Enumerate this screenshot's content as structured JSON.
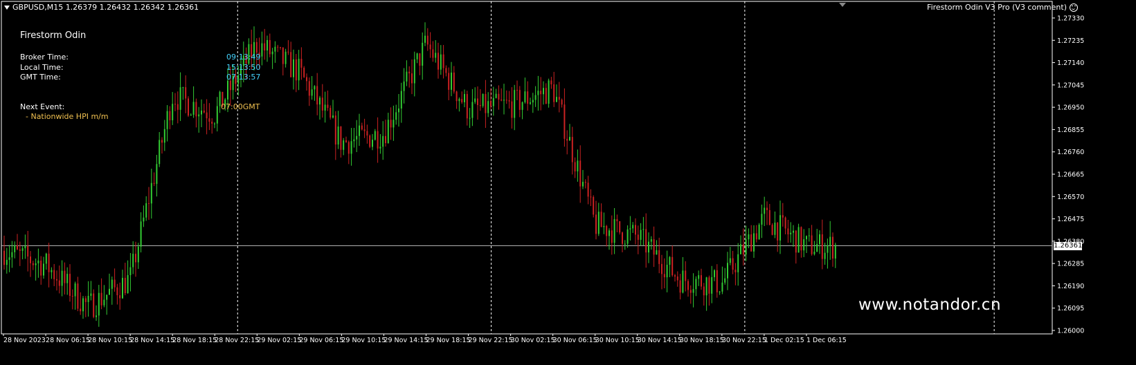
{
  "header": {
    "symbol_info": "GBPUSD,M15  1.26379 1.26432 1.26342 1.26361",
    "indicator_title": "Firestorm Odin V3 Pro (V3 comment)"
  },
  "panel": {
    "title": "Firestorm Odin",
    "broker_label": "Broker Time:",
    "broker_value": "09:13:49",
    "local_label": "Local Time:",
    "local_value": "15:13:50",
    "gmt_label": "GMT Time:",
    "gmt_value": "07:13:57",
    "next_event_label": "Next Event:",
    "next_event_time": "07:00GMT",
    "next_event_name": "- Nationwide HPI m/m"
  },
  "watermark": "www.notandor.cn",
  "colors": {
    "background": "#000000",
    "bull_candle": "#33cc33",
    "bear_candle": "#cc2222",
    "grid": "#ffffff",
    "time_values": "#44d4ff",
    "event_text": "#f0c050"
  },
  "chart_data": {
    "type": "candlestick",
    "current_price": 1.26361,
    "price_tag": "1.26361",
    "ylim": [
      1.26,
      1.2735
    ],
    "y_ticks": [
      "1.27330",
      "1.27235",
      "1.27140",
      "1.27045",
      "1.26950",
      "1.26855",
      "1.26760",
      "1.26665",
      "1.26570",
      "1.26475",
      "1.26380",
      "1.26285",
      "1.26190",
      "1.26095",
      "1.26000"
    ],
    "x_ticks": [
      "28 Nov 2023",
      "28 Nov 06:15",
      "28 Nov 10:15",
      "28 Nov 14:15",
      "28 Nov 18:15",
      "28 Nov 22:15",
      "29 Nov 02:15",
      "29 Nov 06:15",
      "29 Nov 10:15",
      "29 Nov 14:15",
      "29 Nov 18:15",
      "29 Nov 22:15",
      "30 Nov 02:15",
      "30 Nov 06:15",
      "30 Nov 10:15",
      "30 Nov 14:15",
      "30 Nov 18:15",
      "30 Nov 22:15",
      "1 Dec 02:15",
      "1 Dec 06:15"
    ],
    "separator_ticks": [
      "28 Nov 22:15",
      "29 Nov 22:15",
      "30 Nov 22:15"
    ],
    "future_separator_after": "1 Dec 06:15",
    "close_path": [
      [
        "28 Nov 2023",
        1.2634
      ],
      [
        "28 Nov 06:15",
        1.2628
      ],
      [
        "28 Nov 10:15",
        1.261
      ],
      [
        "28 Nov 14:15",
        1.2622
      ],
      [
        "28 Nov 18:15",
        1.27
      ],
      [
        "28 Nov 22:15",
        1.2692
      ],
      [
        "29 Nov 02:15",
        1.2722
      ],
      [
        "29 Nov 06:15",
        1.271
      ],
      [
        "29 Nov 10:15",
        1.268
      ],
      [
        "29 Nov 14:15",
        1.2684
      ],
      [
        "29 Nov 18:15",
        1.2722
      ],
      [
        "29 Nov 22:15",
        1.2694
      ],
      [
        "30 Nov 02:15",
        1.2696
      ],
      [
        "30 Nov 06:15",
        1.2703
      ],
      [
        "30 Nov 10:15",
        1.2645
      ],
      [
        "30 Nov 14:15",
        1.264
      ],
      [
        "30 Nov 18:15",
        1.2622
      ],
      [
        "30 Nov 22:15",
        1.262
      ],
      [
        "1 Dec 02:15",
        1.2648
      ],
      [
        "1 Dec 06:15",
        1.2636
      ]
    ]
  }
}
